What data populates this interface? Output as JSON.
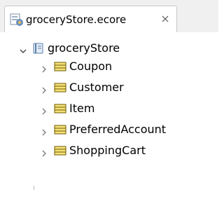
{
  "tab": {
    "title": "groceryStore.ecore",
    "close_glyph": "✕",
    "icon": "ecore-file-icon"
  },
  "tree": {
    "root": {
      "label": "groceryStore",
      "expanded": true,
      "icon": "package-icon"
    },
    "children": [
      {
        "label": "Coupon",
        "expanded": false,
        "icon": "eclass-icon"
      },
      {
        "label": "Customer",
        "expanded": false,
        "icon": "eclass-icon"
      },
      {
        "label": "Item",
        "expanded": false,
        "icon": "eclass-icon"
      },
      {
        "label": "PreferredAccount",
        "expanded": false,
        "icon": "eclass-icon"
      },
      {
        "label": "ShoppingCart",
        "expanded": false,
        "icon": "eclass-icon"
      }
    ]
  },
  "colors": {
    "tab_background": "#ffffff",
    "tab_bar_background": "#f0f0f0",
    "class_icon_fill": "#f7e27a",
    "class_icon_border": "#6b5a00",
    "package_icon": "#5b7fa8"
  }
}
